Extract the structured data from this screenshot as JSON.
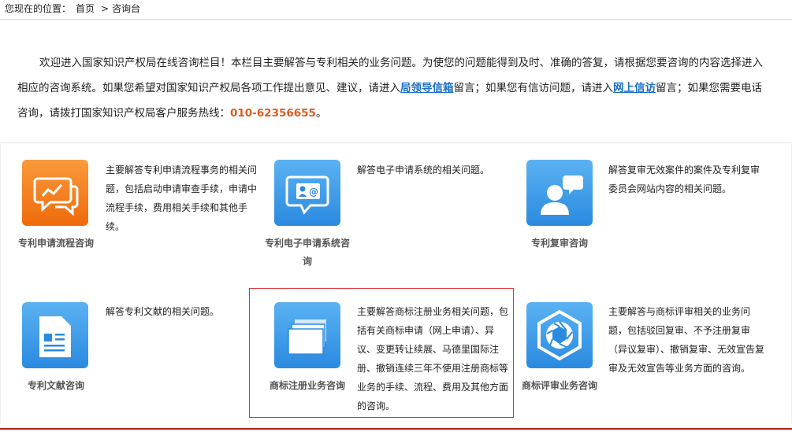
{
  "breadcrumb": {
    "prefix": "您现在的位置：",
    "home": "首页",
    "sep": ">",
    "current": "咨询台"
  },
  "intro": {
    "p1": "欢迎进入国家知识产权局在线咨询栏目！本栏目主要解答与专利相关的业务问题。为使您的问题能得到及时、准确的答复，请根据您要咨询的内容选择进入相应的咨询系统。如果您希望对国家知识产权局各项工作提出意见、建议，请进入",
    "link1": "局领导信箱",
    "p2": "留言；如果您有信访问题，请进入",
    "link2": "网上信访",
    "p3": "留言；如果您需要电话咨询，请拨打国家知识产权局客户服务热线：",
    "phone": "010-62356655",
    "p4": "。"
  },
  "colors": {
    "orange": "#ef6a0a",
    "blue": "#2a8ae0",
    "link": "#1a6fc4",
    "phone": "#e05a1c",
    "highlight": "#d63a3a"
  },
  "items": [
    {
      "title": "专利申请流程咨询",
      "icon": "chart-chat-icon",
      "desc": "主要解答专利申请流程事务的相关问题，包括启动申请审查手续，申请中流程手续，费用相关手续和其他手续。"
    },
    {
      "title": "专利电子申请系统咨询",
      "icon": "contact-card-chat-icon",
      "desc": "解答电子申请系统的相关问题。"
    },
    {
      "title": "专利复审咨询",
      "icon": "person-speech-icon",
      "desc": "解答复审无效案件的案件及专利复审委员会网站内容的相关问题。"
    },
    {
      "title": "专利文献咨询",
      "icon": "document-icon",
      "desc": "解答专利文献的相关问题。"
    },
    {
      "title": "商标注册业务咨询",
      "icon": "stacked-cards-icon",
      "desc": "主要解答商标注册业务相关问题，包括有关商标申请（网上申请）、异议、变更转让续展、马德里国际注册、撤销连续三年不使用注册商标等业务的手续、流程、费用及其他方面的咨询。"
    },
    {
      "title": "商标评审业务咨询",
      "icon": "aperture-hexagon-icon",
      "desc": "主要解答与商标评审相关的业务问题，包括驳回复审、不予注册复审（异议复审）、撤销复审、无效宣告复审及无效宣告等业务方面的咨询。"
    }
  ]
}
